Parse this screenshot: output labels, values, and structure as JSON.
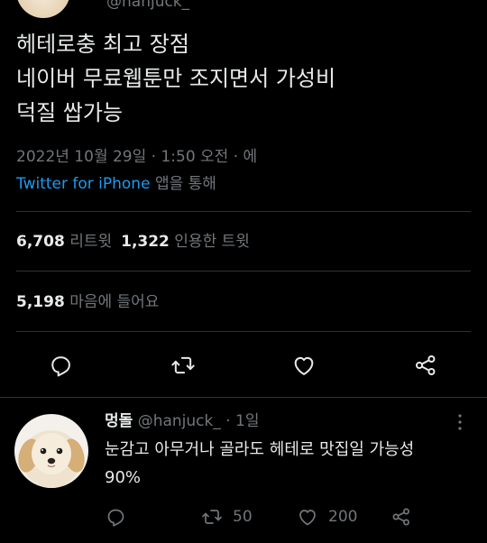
{
  "previous": {
    "handle": "@hanjuck_"
  },
  "tweet": {
    "lines": [
      "헤테로충 최고 장점",
      "네이버 무료웹툰만 조지면서 가성비",
      "덕질 쌉가능"
    ],
    "timestamp": "2022년 10월 29일 · 1:50 오전 · 에",
    "source_link": "Twitter for iPhone",
    "source_suffix": " 앱을 통해"
  },
  "stats": {
    "retweets_count": "6,708",
    "retweets_label": "리트윗",
    "quotes_count": "1,322",
    "quotes_label": "인용한 트윗",
    "likes_count": "5,198",
    "likes_label": "마음에 들어요"
  },
  "reply": {
    "name": "멍돌",
    "handle_time": "@hanjuck_ · 1일",
    "lines": [
      "눈감고 아무거나 골라도 헤테로 맛집일 가능성",
      "90%"
    ],
    "retweet_count": "50",
    "like_count": "200"
  },
  "icons": {
    "reply": "reply-icon",
    "retweet": "retweet-icon",
    "like": "heart-icon",
    "share": "share-icon",
    "more": "more-vertical-icon"
  },
  "colors": {
    "background": "#000000",
    "text": "#e7e9ea",
    "secondary": "#71767b",
    "link": "#1d9bf0",
    "divider": "#2f3336"
  }
}
